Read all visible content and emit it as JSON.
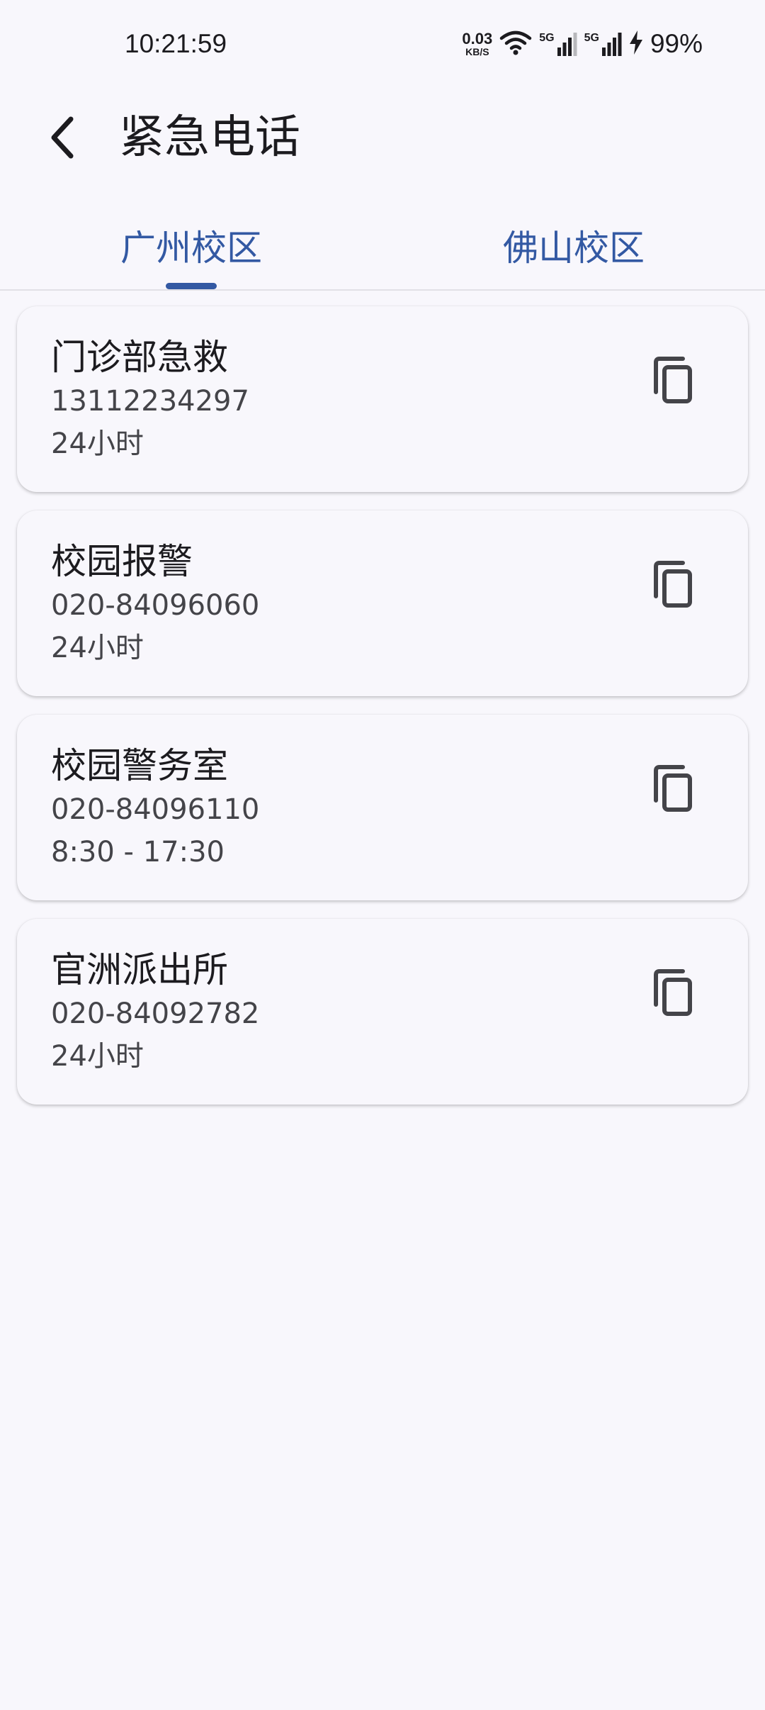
{
  "status_bar": {
    "time": "10:21:59",
    "net_speed_value": "0.03",
    "net_speed_unit": "KB/S",
    "sim1_label": "5G",
    "sim2_label": "5G",
    "battery": "99%"
  },
  "app_bar": {
    "title": "紧急电话"
  },
  "tabs": [
    {
      "label": "广州校区",
      "selected": true
    },
    {
      "label": "佛山校区",
      "selected": false
    }
  ],
  "contacts": [
    {
      "name": "门诊部急救",
      "phone": "13112234297",
      "hours": "24小时"
    },
    {
      "name": "校园报警",
      "phone": "020-84096060",
      "hours": "24小时"
    },
    {
      "name": "校园警务室",
      "phone": "020-84096110",
      "hours": "8:30 - 17:30"
    },
    {
      "name": "官洲派出所",
      "phone": "020-84092782",
      "hours": "24小时"
    }
  ],
  "colors": {
    "accent": "#3359a3",
    "background": "#f8f7fc",
    "text_primary": "#1c1b1f",
    "text_secondary": "#444449"
  },
  "icons": {
    "back": "back-arrow-icon",
    "copy": "copy-icon",
    "wifi": "wifi-icon",
    "signal": "cell-signal-icon",
    "charging": "charging-bolt-icon"
  }
}
